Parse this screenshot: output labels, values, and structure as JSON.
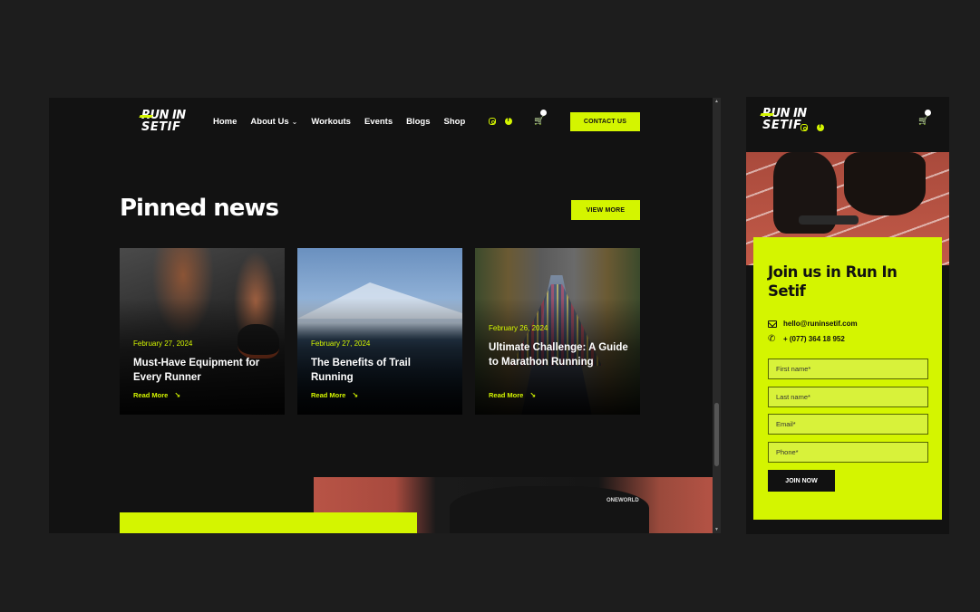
{
  "brand": {
    "line1": "RUN IN",
    "line2": "SETIF",
    "accent": "#d4f500"
  },
  "nav": {
    "items": [
      "Home",
      "About Us",
      "Workouts",
      "Events",
      "Blogs",
      "Shop"
    ],
    "about_chevron": "⌄",
    "social": [
      "instagram-icon",
      "facebook-icon"
    ],
    "cart_glyph": "🛒",
    "contact_label": "CONTACT US"
  },
  "pinned": {
    "title": "Pinned news",
    "view_more_label": "VIEW MORE",
    "cards": [
      {
        "date": "February 27, 2024",
        "title": "Must-Have Equipment for Every Runner",
        "link": "Read More"
      },
      {
        "date": "February 27, 2024",
        "title": "The Benefits of Trail Running",
        "link": "Read More"
      },
      {
        "date": "February 26, 2024",
        "title": "Ultimate Challenge: A Guide to Marathon Running",
        "link": "Read More"
      }
    ],
    "link_arrow": "↘"
  },
  "bottom": {
    "brand_text": "ONEWORLD"
  },
  "scroll": {
    "up": "▲",
    "down": "▼"
  },
  "mobile": {
    "join_title": "Join us in Run In Setif",
    "email": "hello@runinsetif.com",
    "phone": "+ (077) 364 18 952",
    "phone_glyph": "✆",
    "fields": [
      "First name*",
      "Last name*",
      "Email*",
      "Phone*"
    ],
    "join_label": "JOIN NOW"
  }
}
